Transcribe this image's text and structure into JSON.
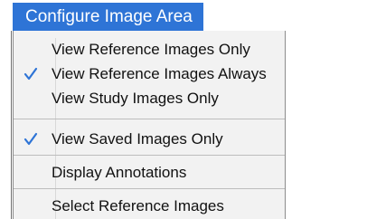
{
  "menu": {
    "title": "Configure Image Area",
    "items": [
      {
        "label": "View Reference Images Only",
        "checked": false
      },
      {
        "label": "View Reference Images Always",
        "checked": true
      },
      {
        "label": "View Study Images Only",
        "checked": false
      },
      {
        "label": "View Saved Images Only",
        "checked": true
      },
      {
        "label": "Display Annotations",
        "checked": false
      },
      {
        "label": "Select Reference Images",
        "checked": false
      }
    ]
  },
  "colors": {
    "title_bg": "#2e74d6",
    "check": "#2e74d6"
  },
  "icons": {
    "check": "checkmark-icon"
  }
}
